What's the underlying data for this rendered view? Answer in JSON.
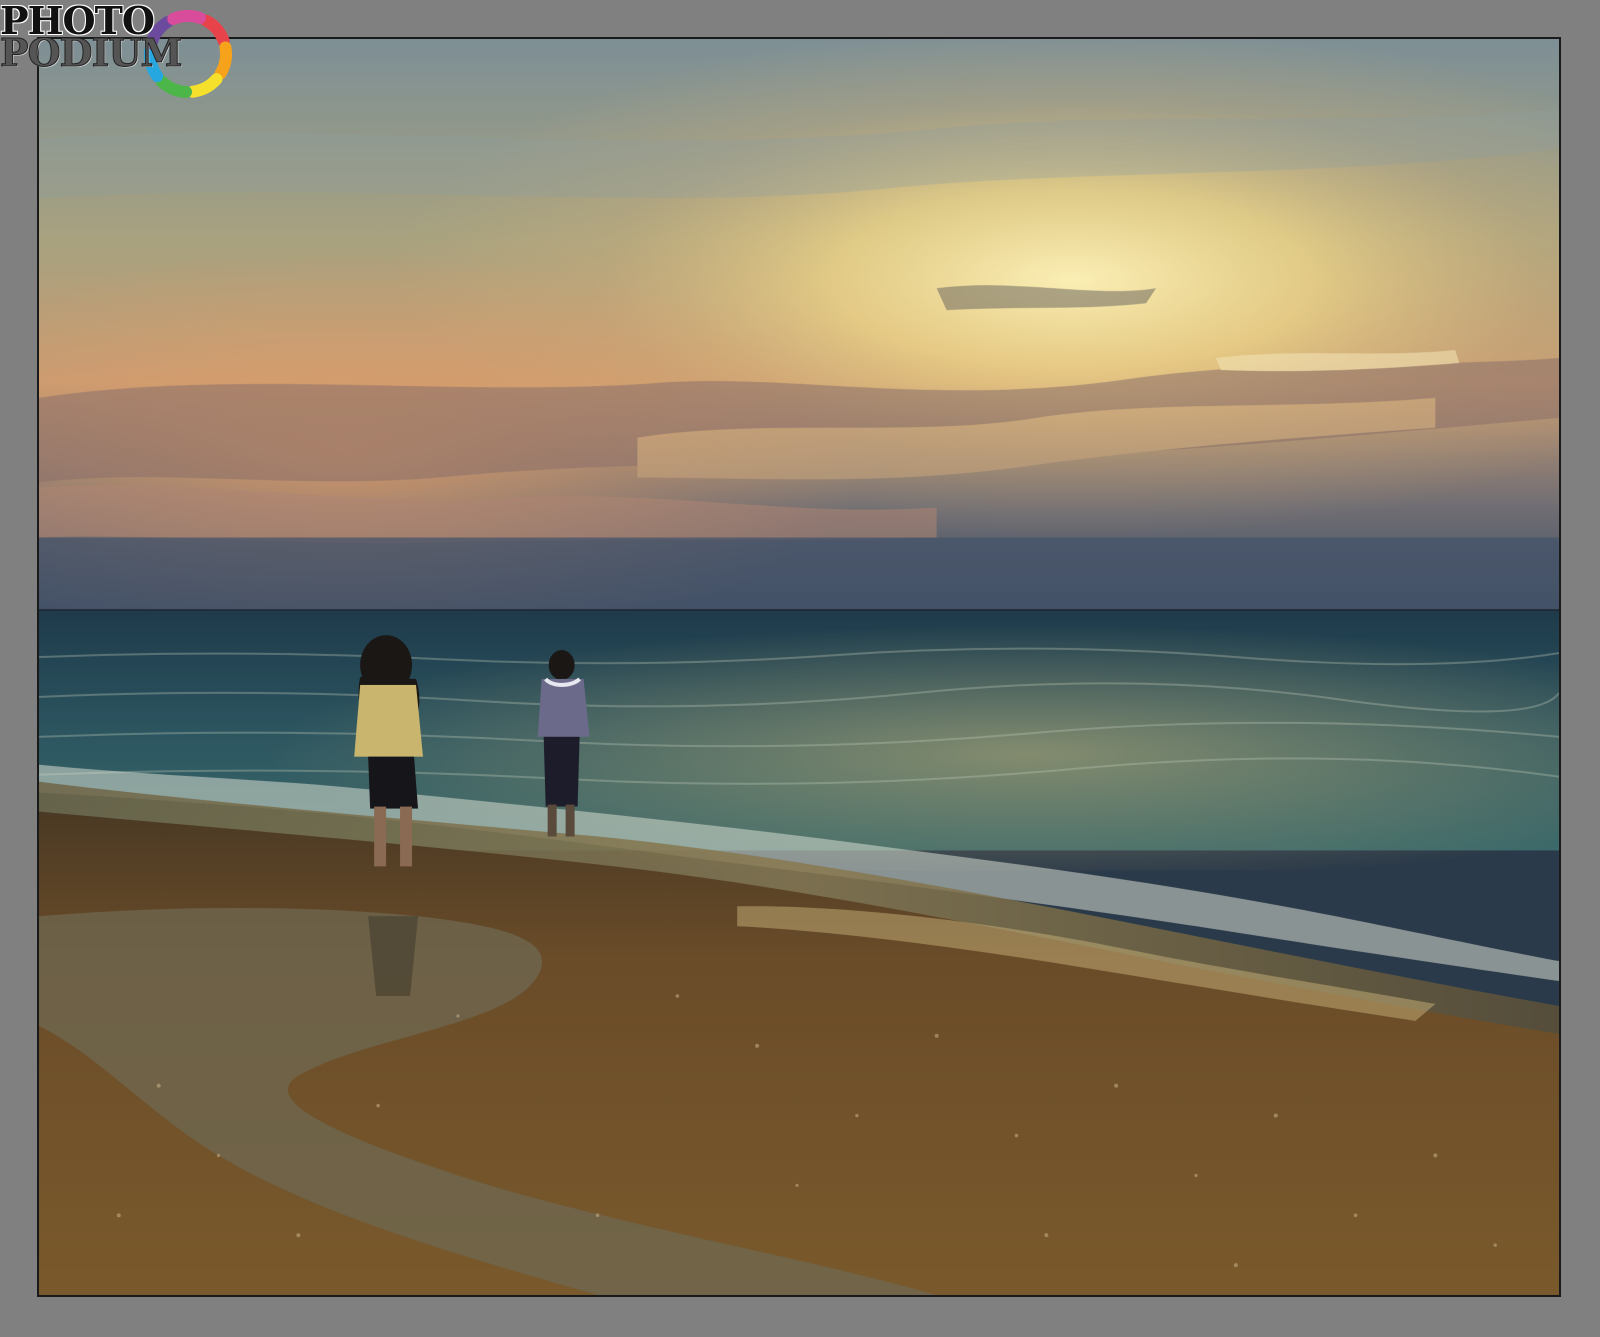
{
  "logo": {
    "line1": "PHOTO",
    "line2": "PODIUM",
    "ring_colors": [
      "#e8424b",
      "#f7a21b",
      "#f5e12c",
      "#4cb648",
      "#27a7df",
      "#6c4b9e",
      "#d94c9b"
    ]
  },
  "scene": {
    "sky_colors": {
      "top": "#7f9193",
      "glow": "#f6e7a3",
      "orange": "#e8a86a",
      "horizon": "#445468"
    },
    "sea_color": "#2d4f5c",
    "sand_color": "#6a4a26",
    "figures": [
      "adult",
      "child"
    ]
  }
}
